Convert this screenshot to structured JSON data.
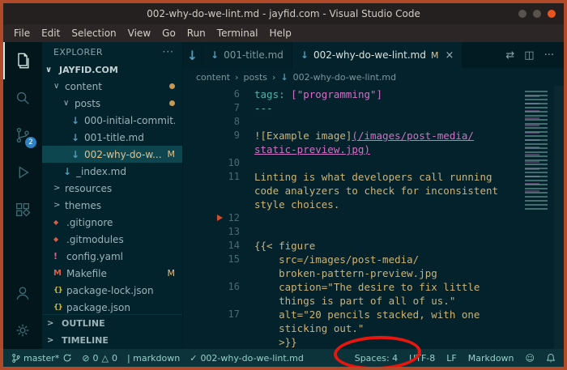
{
  "window": {
    "title": "002-why-do-we-lint.md - jayfid.com - Visual Studio Code"
  },
  "menu": {
    "items": [
      "File",
      "Edit",
      "Selection",
      "View",
      "Go",
      "Run",
      "Terminal",
      "Help"
    ]
  },
  "activity": {
    "scm_badge": "2"
  },
  "icons": {
    "chevron_down": "∨",
    "chevron_right": ">",
    "more": "···",
    "close": "×",
    "markdown": "↓",
    "git": "◆",
    "yaml": "!",
    "makefile": "M",
    "json": "{}",
    "crumb_sep": "›",
    "error": "⊘",
    "warning": "△",
    "check": "✓",
    "smiley": "☺",
    "compare": "⇄",
    "split": "◫"
  },
  "sidebar": {
    "header": "EXPLORER",
    "root": "JAYFID.COM",
    "items": [
      {
        "label": "content"
      },
      {
        "label": "posts"
      },
      {
        "label": "000-initial-commit.md"
      },
      {
        "label": "001-title.md"
      },
      {
        "label": "002-why-do-w...",
        "badge": "M"
      },
      {
        "label": "_index.md"
      },
      {
        "label": "resources"
      },
      {
        "label": "themes"
      },
      {
        "label": ".gitignore"
      },
      {
        "label": ".gitmodules"
      },
      {
        "label": "config.yaml"
      },
      {
        "label": "Makefile",
        "badge": "M"
      },
      {
        "label": "package-lock.json"
      },
      {
        "label": "package.json"
      }
    ],
    "outline": "OUTLINE",
    "timeline": "TIMELINE"
  },
  "tabs": {
    "one": {
      "label": "001-title.md"
    },
    "two": {
      "label": "002-why-do-we-lint.md",
      "badge": "M"
    }
  },
  "breadcrumbs": {
    "items": [
      "content",
      "posts",
      "002-why-do-we-lint.md"
    ]
  },
  "editor": {
    "rows": [
      {
        "n": "6",
        "a": "tags:",
        "b": " [\"programming\"]"
      },
      {
        "n": "7",
        "a": "---"
      },
      {
        "n": "8"
      },
      {
        "n": "9",
        "a": "![Example image]",
        "b": "(/images/post-media/"
      },
      {
        "n": "",
        "b": "static-preview.jpg)"
      },
      {
        "n": "10"
      },
      {
        "n": "11",
        "a": "Linting is what developers call running"
      },
      {
        "n": "",
        "a": "code analyzers to check for inconsistent"
      },
      {
        "n": "",
        "a": "style choices."
      },
      {
        "n": "12"
      },
      {
        "n": "13"
      },
      {
        "n": "14",
        "a": "{{< figure"
      },
      {
        "n": "15",
        "a": "    src=/images/post-media/"
      },
      {
        "n": "",
        "a": "    broken-pattern-preview.jpg"
      },
      {
        "n": "16",
        "a": "    caption=\"The desire to fix little"
      },
      {
        "n": "",
        "a": "    things is part of all of us.\""
      },
      {
        "n": "17",
        "a": "    alt=\"20 pencils stacked, with one"
      },
      {
        "n": "",
        "a": "    sticking out.\""
      },
      {
        "n": "",
        "a": "    >}}"
      }
    ]
  },
  "status": {
    "branch": "master*",
    "errors": "0",
    "warnings": "0",
    "linter": "| markdown",
    "file_status": "002-why-do-we-lint.md",
    "indent": "Spaces: 4",
    "encoding": "UTF-8",
    "eol": "LF",
    "language": "Markdown"
  },
  "annotation": {
    "color": "#e5170e",
    "target": "Spaces: 4"
  }
}
